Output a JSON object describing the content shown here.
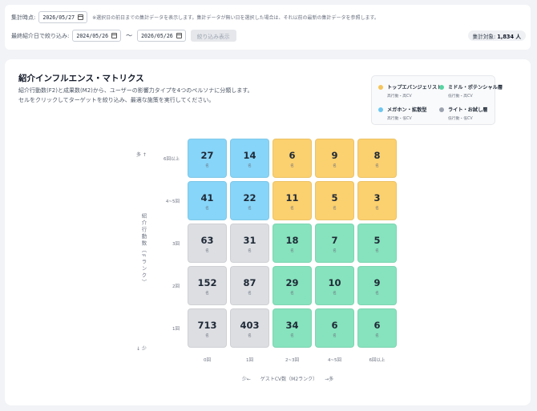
{
  "filters": {
    "aggregation_label": "集計時点:",
    "aggregation_date": "2026/05/27",
    "note": "※選択日の前日までの集計データを表示します。集計データが無い日を選択した場合は、それ以前の最新の集計データを参照します。",
    "intro_label": "最終紹介日で絞り込み:",
    "from_date": "2024/05/26",
    "tilde": "〜",
    "to_date": "2026/05/26",
    "apply_button": "絞り込み表示",
    "total_label": "集計対象:",
    "total_value": "1,834 人"
  },
  "matrix": {
    "title": "紹介インフルエンス・マトリクス",
    "desc1": "紹介行動数(F2)と成果数(M2)から、ユーザーの影響力タイプを4つのペルソナに分類します。",
    "desc2": "セルをクリックしてターゲットを絞り込み、最適な施策を実行してください。",
    "unit": "名",
    "legend": [
      {
        "name": "トップエバンジェリスト",
        "sub": "高行動・高CV",
        "color": "#f5c55c"
      },
      {
        "name": "ミドル・ポテンシャル層",
        "sub": "低行動・高CV",
        "color": "#58d3a2"
      },
      {
        "name": "メガホン・拡散型",
        "sub": "高行動・低CV",
        "color": "#6ec6f0"
      },
      {
        "name": "ライト・お試し層",
        "sub": "低行動・低CV",
        "color": "#9ca3af"
      }
    ],
    "y_top": "多 ↑",
    "y_bottom": "↓ 少",
    "y_axis_title": "紹介行動数（Fランク）",
    "x_axis_title": "少←　　ゲストCV数（M2ランク）　　→多",
    "row_labels": [
      "6回以上",
      "4~5回",
      "3回",
      "2回",
      "1回"
    ],
    "col_labels": [
      "0回",
      "1回",
      "2~3回",
      "4~5回",
      "6回以上"
    ],
    "rows": [
      [
        "27",
        "14",
        "6",
        "9",
        "8"
      ],
      [
        "41",
        "22",
        "11",
        "5",
        "3"
      ],
      [
        "63",
        "31",
        "18",
        "7",
        "5"
      ],
      [
        "152",
        "87",
        "29",
        "10",
        "9"
      ],
      [
        "713",
        "403",
        "34",
        "6",
        "6"
      ]
    ],
    "row_types": [
      [
        "megaphone",
        "megaphone",
        "top",
        "top",
        "top"
      ],
      [
        "megaphone",
        "megaphone",
        "top",
        "top",
        "top"
      ],
      [
        "light",
        "light",
        "mid",
        "mid",
        "mid"
      ],
      [
        "light",
        "light",
        "mid",
        "mid",
        "mid"
      ],
      [
        "light",
        "light",
        "mid",
        "mid",
        "mid"
      ]
    ],
    "type_colors": {
      "megaphone": "#87d5f8",
      "top": "#fbd06e",
      "light": "#dcdee2",
      "mid": "#86e3bd"
    }
  }
}
